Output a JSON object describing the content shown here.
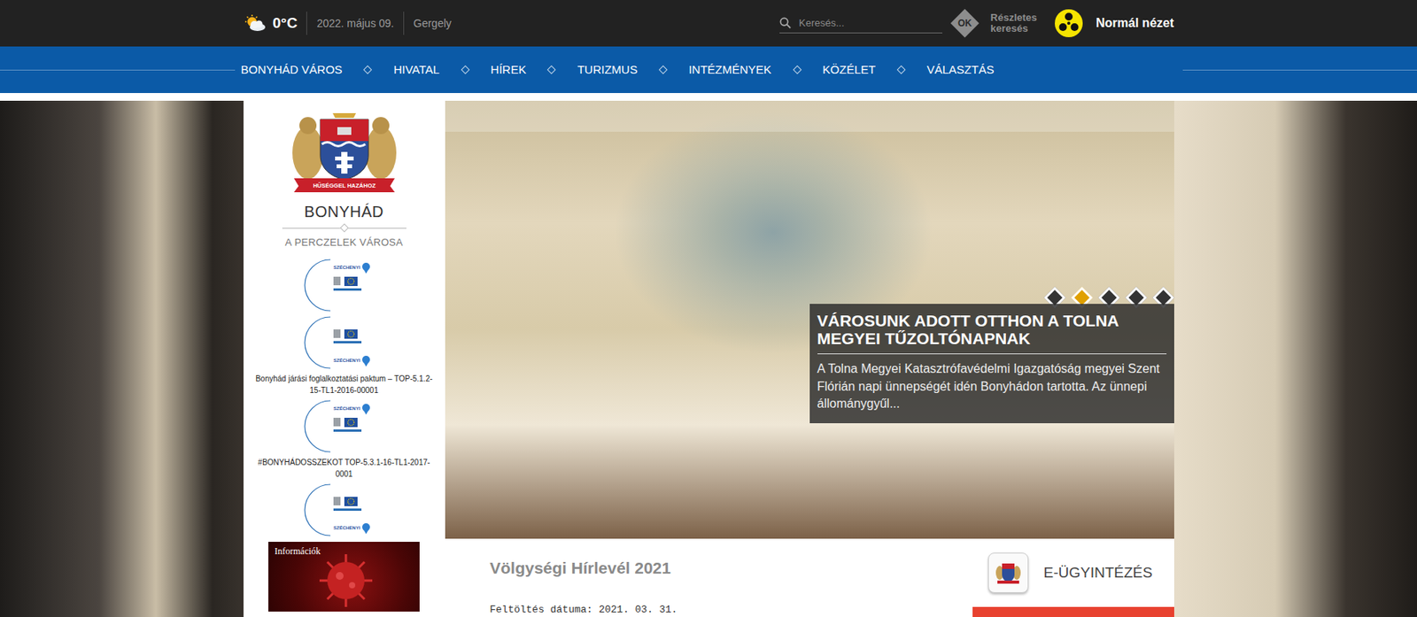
{
  "top_bar": {
    "temperature": "0°C",
    "date": "2022. május 09.",
    "nameday": "Gergely",
    "search": {
      "placeholder": "Keresés..."
    },
    "ok_button": "OK",
    "advanced_search": "Részletes keresés",
    "view_mode": "Normál nézet"
  },
  "nav": {
    "items": [
      "BONYHÁD VÁROS",
      "HIVATAL",
      "HÍREK",
      "TURIZMUS",
      "INTÉZMÉNYEK",
      "KÖZÉLET",
      "VÁLASZTÁS"
    ]
  },
  "sidebar": {
    "logo_motto": "HŰSÉGGEL HAZÁHOZ",
    "title": "BONYHÁD",
    "subtitle": "A PERCZELEK VÁROSA",
    "projects": [
      {
        "badge": "SZÉCHENYI"
      },
      {
        "badge": "SZÉCHENYI"
      },
      {
        "caption": "Bonyhád járási foglalkoztatási paktum – TOP-5.1.2-15-TL1-2016-00001",
        "badge": "SZÉCHENYI"
      },
      {
        "caption": "#BONYHÁDOSSZEKOT TOP-5.3.1-16-TL1-2017-0001",
        "badge": "SZÉCHENYI"
      }
    ],
    "info_box": "Információk"
  },
  "slider": {
    "dots": [
      {
        "selected": false
      },
      {
        "selected": true
      },
      {
        "selected": false
      },
      {
        "selected": false
      },
      {
        "selected": false
      }
    ],
    "title": "VÁROSUNK ADOTT OTTHON A TOLNA MEGYEI TŰZOLTÓNAPNAK",
    "text": "A Tolna Megyei Katasztrófavédelmi Igazgatóság megyei Szent Flórián napi ünnepségét idén Bonyhádon tartotta. Az ünnepi állománygyűl..."
  },
  "news": {
    "title": "Völgységi Hírlevél 2021",
    "upload_date": "Feltöltés dátuma: 2021. 03. 31."
  },
  "e_admin": {
    "label": "E-ÜGYINTÉZÉS"
  }
}
